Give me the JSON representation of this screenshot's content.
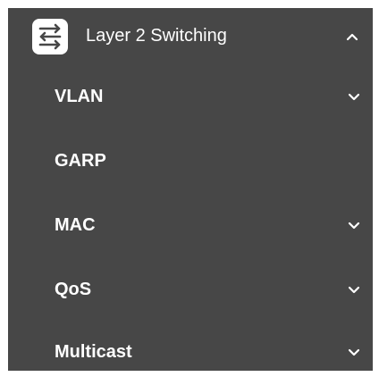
{
  "menu": {
    "section": {
      "title": "Layer 2 Switching",
      "icon": "switch-arrows-icon",
      "expanded": true
    },
    "items": [
      {
        "label": "VLAN",
        "has_submenu": true
      },
      {
        "label": "GARP",
        "has_submenu": false
      },
      {
        "label": "MAC",
        "has_submenu": true
      },
      {
        "label": "QoS",
        "has_submenu": true
      },
      {
        "label": "Multicast",
        "has_submenu": true
      }
    ]
  },
  "colors": {
    "panel_background": "#474747",
    "text": "#ffffff",
    "icon_tile": "#ffffff",
    "icon_glyph": "#474747"
  }
}
